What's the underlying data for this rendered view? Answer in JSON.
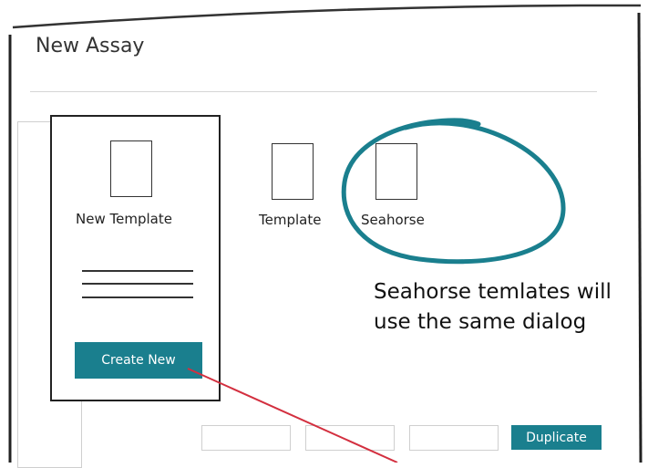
{
  "dialog": {
    "title": "New Assay"
  },
  "templates": [
    {
      "label": "New Template",
      "selected": true
    },
    {
      "label": "Template",
      "selected": false
    },
    {
      "label": "Seahorse",
      "selected": false,
      "highlighted": true
    }
  ],
  "card": {
    "create_button_label": "Create New"
  },
  "footer": {
    "duplicate_label": "Duplicate"
  },
  "annotation": {
    "text": "Seahorse temlates will use the same dialog"
  },
  "colors": {
    "accent": "#1a7f8e",
    "circle": "#1a7f8e",
    "arrow": "#d32f3f",
    "frame": "#222222"
  }
}
